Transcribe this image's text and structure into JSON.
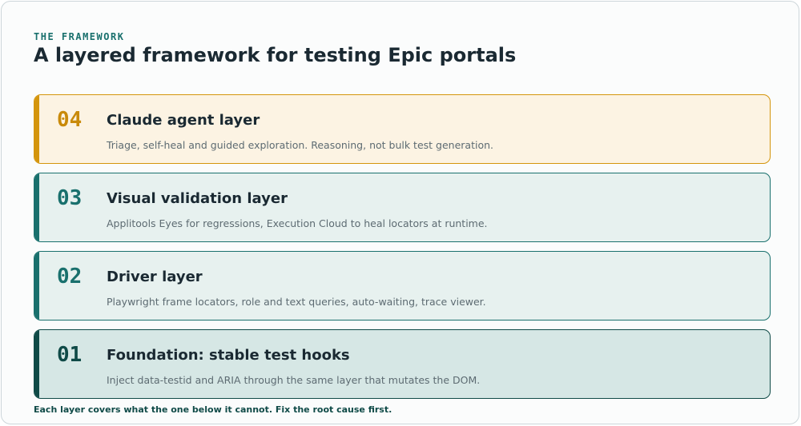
{
  "eyebrow": "THE FRAMEWORK",
  "title": "A layered framework for testing Epic portals",
  "layers": [
    {
      "number": "04",
      "name": "Claude agent layer",
      "description": "Triage, self-heal and guided exploration. Reasoning, not bulk test generation.",
      "accent": "#d4950c"
    },
    {
      "number": "03",
      "name": "Visual validation layer",
      "description": "Applitools Eyes for regressions, Execution Cloud to heal locators at runtime.",
      "accent": "#19706d"
    },
    {
      "number": "02",
      "name": "Driver layer",
      "description": "Playwright frame locators, role and text queries, auto-waiting, trace viewer.",
      "accent": "#19706d"
    },
    {
      "number": "01",
      "name": "Foundation: stable test hooks",
      "description": "Inject data-testid and ARIA through the same layer that mutates the DOM.",
      "accent": "#0f4a47"
    }
  ],
  "footer": "Each layer covers what the one below it cannot. Fix the root cause first."
}
